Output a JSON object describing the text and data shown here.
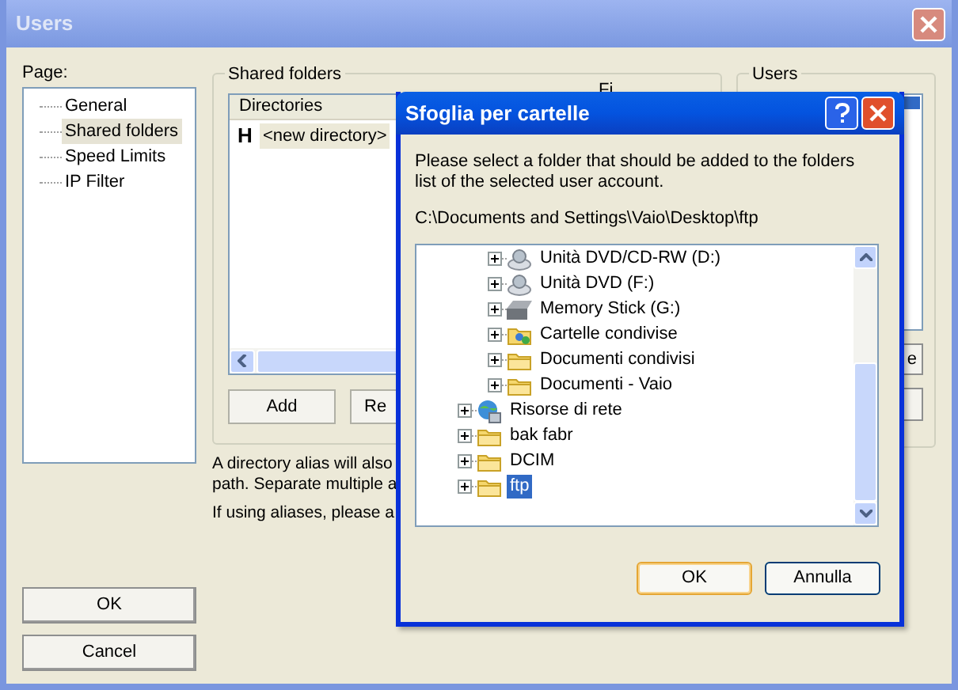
{
  "window": {
    "title": "Users",
    "active": false
  },
  "page_label": "Page:",
  "pages": [
    {
      "label": "General",
      "selected": false
    },
    {
      "label": "Shared folders",
      "selected": true
    },
    {
      "label": "Speed Limits",
      "selected": false
    },
    {
      "label": "IP Filter",
      "selected": false
    }
  ],
  "shared_folders": {
    "title": "Shared folders",
    "columns": [
      "Directories",
      "Fi"
    ],
    "rows": [
      {
        "flag": "H",
        "path": "<new directory>"
      }
    ],
    "buttons": [
      "Add",
      "Re"
    ],
    "notes": [
      "A directory alias will also",
      "path. Separate multiple a",
      "If using aliases, please a"
    ]
  },
  "users": {
    "title": "Users",
    "buttons": [
      "e"
    ]
  },
  "buttons": [
    "OK",
    "Cancel"
  ],
  "dialog": {
    "title": "Sfoglia per cartelle",
    "message": "Please select a folder that should be added to the folders list of the selected user account.",
    "path": "C:\\Documents and Settings\\Vaio\\Desktop\\ftp",
    "tree": [
      {
        "children": [
          {
            "label": "Unità DVD/CD-RW (D:)",
            "kind": "cd",
            "expanded": false,
            "selected": false
          },
          {
            "label": "Unità DVD (F:)",
            "kind": "cd",
            "expanded": false,
            "selected": false
          },
          {
            "label": "Memory Stick (G:)",
            "kind": "drive",
            "expanded": false,
            "selected": false
          },
          {
            "label": "Cartelle condivise",
            "kind": "shared",
            "expanded": false,
            "selected": false
          },
          {
            "label": "Documenti condivisi",
            "kind": "folder",
            "expanded": false,
            "selected": false
          },
          {
            "label": "Documenti - Vaio",
            "kind": "folder",
            "expanded": false,
            "selected": false
          }
        ]
      },
      {
        "label": "Risorse di rete",
        "kind": "network",
        "expanded": false,
        "selected": false
      },
      {
        "label": "bak fabr",
        "kind": "folder",
        "expanded": false,
        "selected": false
      },
      {
        "label": "DCIM",
        "kind": "folder",
        "expanded": false,
        "selected": false
      },
      {
        "label": "ftp",
        "kind": "folder",
        "expanded": false,
        "selected": true
      }
    ],
    "buttons": [
      {
        "label": "OK",
        "default": true
      },
      {
        "label": "Annulla",
        "default": false
      }
    ]
  }
}
